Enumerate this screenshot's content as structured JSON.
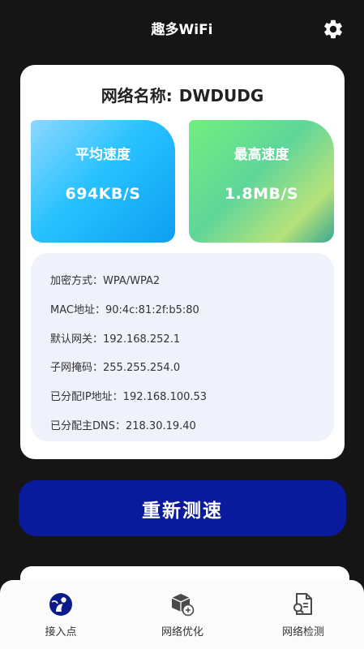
{
  "header": {
    "title": "趣多WiFi",
    "settings_icon": "gear-icon"
  },
  "network": {
    "name_label": "网络名称:",
    "name_value": "DWDUDG"
  },
  "speeds": {
    "average_label": "平均速度",
    "average_value": "694KB/S",
    "max_label": "最高速度",
    "max_value": "1.8MB/S"
  },
  "info": [
    "加密方式：WPA/WPA2",
    "MAC地址：90:4c:81:2f:b5:80",
    "默认网关：192.168.252.1",
    "子网掩码：255.255.254.0",
    "已分配IP地址：192.168.100.53",
    "已分配主DNS：218.30.19.40"
  ],
  "retest_label": "重新测速",
  "nav": [
    {
      "label": "接入点",
      "icon": "access-point-icon",
      "active": true
    },
    {
      "label": "网络优化",
      "icon": "network-optimize-icon",
      "active": false
    },
    {
      "label": "网络检测",
      "icon": "network-check-icon",
      "active": false
    }
  ],
  "colors": {
    "background": "#151515",
    "primary_button": "#0a1a9c",
    "info_panel": "#eff1fb",
    "active_nav_icon": "#0d1a8c"
  }
}
